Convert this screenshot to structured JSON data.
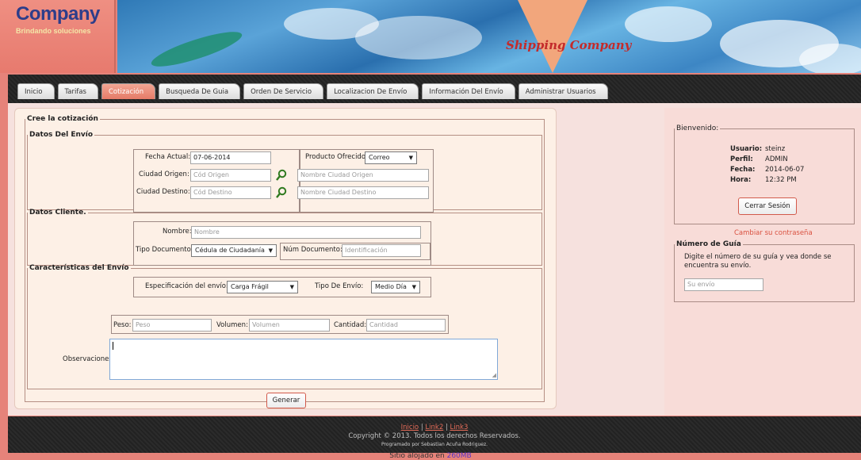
{
  "brand": {
    "company": "Company",
    "tagline": "Brindando soluciones",
    "banner_text": "Shipping Company"
  },
  "nav": {
    "tabs": [
      {
        "label": "Inicio"
      },
      {
        "label": "Tarifas"
      },
      {
        "label": "Cotización",
        "active": true
      },
      {
        "label": "Busqueda De Guia"
      },
      {
        "label": "Orden De Servicio"
      },
      {
        "label": "Localizacion De Envío"
      },
      {
        "label": "Información Del Envío"
      },
      {
        "label": "Administrar Usuarios"
      }
    ]
  },
  "form": {
    "legend": "Cree la cotización",
    "envio": {
      "legend": "Datos Del Envío",
      "fecha_label": "Fecha Actual:",
      "fecha_value": "07-06-2014",
      "producto_label": "Producto Ofrecido:",
      "producto_value": "Correo",
      "origen_label": "Ciudad Origen:",
      "origen_placeholder": "Cód Origen",
      "origen_nombre_placeholder": "Nombre Ciudad Origen",
      "destino_label": "Ciudad Destino:",
      "destino_placeholder": "Cód Destino",
      "destino_nombre_placeholder": "Nombre Ciudad Destino"
    },
    "cliente": {
      "legend": "Datos Cliente.",
      "nombre_label": "Nombre:",
      "nombre_placeholder": "Nombre",
      "tipo_doc_label": "Tipo Documento:",
      "tipo_doc_value": "Cédula de Ciudadanía",
      "num_doc_label": "Núm Documento:",
      "num_doc_placeholder": "Identificación"
    },
    "caracteristicas": {
      "legend": "Características del Envío",
      "especificacion_label": "Especificación del envío:",
      "especificacion_value": "Carga Frágil",
      "tipo_envio_label": "Tipo De Envío:",
      "tipo_envio_value": "Medio Día",
      "peso_label": "Peso:",
      "peso_placeholder": "Peso",
      "volumen_label": "Volumen:",
      "volumen_placeholder": "Volumen",
      "cantidad_label": "Cantidad:",
      "cantidad_placeholder": "Cantidad",
      "observaciones_label": "Observaciones"
    },
    "submit_label": "Generar"
  },
  "sidebar": {
    "welcome_legend": "Bienvenido:",
    "usuario_label": "Usuario:",
    "usuario_value": "steinz",
    "perfil_label": "Perfil:",
    "perfil_value": "ADMIN",
    "fecha_label": "Fecha:",
    "fecha_value": "2014-06-07",
    "hora_label": "Hora:",
    "hora_value": "12:32 PM",
    "logout_label": "Cerrar Sesión",
    "change_password": "Cambiar su contraseña",
    "guia_legend": "Número de Guía",
    "guia_text": "Digite el número de su guía y vea donde se encuentra su envío.",
    "guia_placeholder": "Su envío"
  },
  "footer": {
    "link1": "Inicio",
    "link2": "Link2",
    "link3": "Link3",
    "separator": "|",
    "copyright": "Copyright © 2013. Todos los derechos Reservados.",
    "programmer": "Programado por Sebastian Acuña Rodriguez.",
    "hosted_prefix": "Sitio alojado en",
    "hosted_link": "260MB"
  },
  "colors": {
    "accent": "#e57b68",
    "nav_dark": "#252525",
    "content_bg": "#fdf0e6",
    "sidebar_bg": "#f8dcd8"
  }
}
